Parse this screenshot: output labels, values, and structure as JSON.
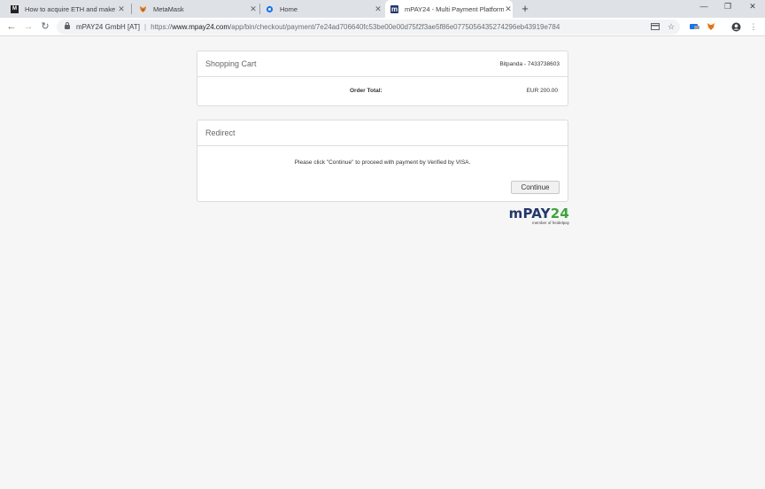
{
  "tabs": [
    {
      "title": "How to acquire ETH and make a",
      "favicon": "M",
      "favicon_name": "medium-icon",
      "active": false
    },
    {
      "title": "MetaMask",
      "favicon": "fox",
      "favicon_name": "metamask-fox-icon",
      "active": false
    },
    {
      "title": "Home",
      "favicon": "gear",
      "favicon_name": "home-gear-icon",
      "active": false
    },
    {
      "title": "mPAY24 - Multi Payment Platform",
      "favicon": "m",
      "favicon_name": "mpay24-icon",
      "active": true
    }
  ],
  "toolbar": {
    "org_name": "mPAY24 GmbH [AT]",
    "url_scheme": "https://",
    "url_host": "www.mpay24.com",
    "url_path": "/app/bin/checkout/payment/7e24ad706640fc53be00e00d75f2f3ae5f86e0775056435274296eb43919e784"
  },
  "cart": {
    "title": "Shopping Cart",
    "merchant": "Bitpanda - 7433738603",
    "total_label": "Order Total:",
    "total_value": "EUR 200.00"
  },
  "redirect": {
    "title": "Redirect",
    "message": "Please click \"Continue\" to proceed with payment by Verified by VISA.",
    "button_label": "Continue"
  },
  "logo": {
    "text_m": "m",
    "text_pay": "PAY",
    "text_24": "24",
    "tagline": "member of heidelpay"
  },
  "colors": {
    "brand_navy": "#24386b",
    "brand_green": "#3da43a",
    "tabstrip": "#dee1e6"
  }
}
